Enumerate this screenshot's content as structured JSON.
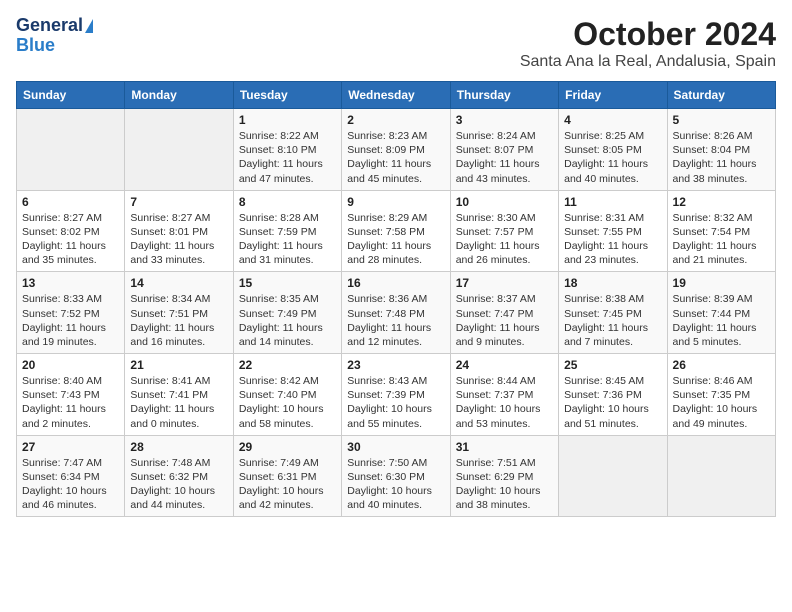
{
  "logo": {
    "line1": "General",
    "line2": "Blue"
  },
  "title": "October 2024",
  "subtitle": "Santa Ana la Real, Andalusia, Spain",
  "weekdays": [
    "Sunday",
    "Monday",
    "Tuesday",
    "Wednesday",
    "Thursday",
    "Friday",
    "Saturday"
  ],
  "weeks": [
    [
      {
        "day": "",
        "info": ""
      },
      {
        "day": "",
        "info": ""
      },
      {
        "day": "1",
        "sunrise": "8:22 AM",
        "sunset": "8:10 PM",
        "daylight": "11 hours and 47 minutes."
      },
      {
        "day": "2",
        "sunrise": "8:23 AM",
        "sunset": "8:09 PM",
        "daylight": "11 hours and 45 minutes."
      },
      {
        "day": "3",
        "sunrise": "8:24 AM",
        "sunset": "8:07 PM",
        "daylight": "11 hours and 43 minutes."
      },
      {
        "day": "4",
        "sunrise": "8:25 AM",
        "sunset": "8:05 PM",
        "daylight": "11 hours and 40 minutes."
      },
      {
        "day": "5",
        "sunrise": "8:26 AM",
        "sunset": "8:04 PM",
        "daylight": "11 hours and 38 minutes."
      }
    ],
    [
      {
        "day": "6",
        "sunrise": "8:27 AM",
        "sunset": "8:02 PM",
        "daylight": "11 hours and 35 minutes."
      },
      {
        "day": "7",
        "sunrise": "8:27 AM",
        "sunset": "8:01 PM",
        "daylight": "11 hours and 33 minutes."
      },
      {
        "day": "8",
        "sunrise": "8:28 AM",
        "sunset": "7:59 PM",
        "daylight": "11 hours and 31 minutes."
      },
      {
        "day": "9",
        "sunrise": "8:29 AM",
        "sunset": "7:58 PM",
        "daylight": "11 hours and 28 minutes."
      },
      {
        "day": "10",
        "sunrise": "8:30 AM",
        "sunset": "7:57 PM",
        "daylight": "11 hours and 26 minutes."
      },
      {
        "day": "11",
        "sunrise": "8:31 AM",
        "sunset": "7:55 PM",
        "daylight": "11 hours and 23 minutes."
      },
      {
        "day": "12",
        "sunrise": "8:32 AM",
        "sunset": "7:54 PM",
        "daylight": "11 hours and 21 minutes."
      }
    ],
    [
      {
        "day": "13",
        "sunrise": "8:33 AM",
        "sunset": "7:52 PM",
        "daylight": "11 hours and 19 minutes."
      },
      {
        "day": "14",
        "sunrise": "8:34 AM",
        "sunset": "7:51 PM",
        "daylight": "11 hours and 16 minutes."
      },
      {
        "day": "15",
        "sunrise": "8:35 AM",
        "sunset": "7:49 PM",
        "daylight": "11 hours and 14 minutes."
      },
      {
        "day": "16",
        "sunrise": "8:36 AM",
        "sunset": "7:48 PM",
        "daylight": "11 hours and 12 minutes."
      },
      {
        "day": "17",
        "sunrise": "8:37 AM",
        "sunset": "7:47 PM",
        "daylight": "11 hours and 9 minutes."
      },
      {
        "day": "18",
        "sunrise": "8:38 AM",
        "sunset": "7:45 PM",
        "daylight": "11 hours and 7 minutes."
      },
      {
        "day": "19",
        "sunrise": "8:39 AM",
        "sunset": "7:44 PM",
        "daylight": "11 hours and 5 minutes."
      }
    ],
    [
      {
        "day": "20",
        "sunrise": "8:40 AM",
        "sunset": "7:43 PM",
        "daylight": "11 hours and 2 minutes."
      },
      {
        "day": "21",
        "sunrise": "8:41 AM",
        "sunset": "7:41 PM",
        "daylight": "11 hours and 0 minutes."
      },
      {
        "day": "22",
        "sunrise": "8:42 AM",
        "sunset": "7:40 PM",
        "daylight": "10 hours and 58 minutes."
      },
      {
        "day": "23",
        "sunrise": "8:43 AM",
        "sunset": "7:39 PM",
        "daylight": "10 hours and 55 minutes."
      },
      {
        "day": "24",
        "sunrise": "8:44 AM",
        "sunset": "7:37 PM",
        "daylight": "10 hours and 53 minutes."
      },
      {
        "day": "25",
        "sunrise": "8:45 AM",
        "sunset": "7:36 PM",
        "daylight": "10 hours and 51 minutes."
      },
      {
        "day": "26",
        "sunrise": "8:46 AM",
        "sunset": "7:35 PM",
        "daylight": "10 hours and 49 minutes."
      }
    ],
    [
      {
        "day": "27",
        "sunrise": "7:47 AM",
        "sunset": "6:34 PM",
        "daylight": "10 hours and 46 minutes."
      },
      {
        "day": "28",
        "sunrise": "7:48 AM",
        "sunset": "6:32 PM",
        "daylight": "10 hours and 44 minutes."
      },
      {
        "day": "29",
        "sunrise": "7:49 AM",
        "sunset": "6:31 PM",
        "daylight": "10 hours and 42 minutes."
      },
      {
        "day": "30",
        "sunrise": "7:50 AM",
        "sunset": "6:30 PM",
        "daylight": "10 hours and 40 minutes."
      },
      {
        "day": "31",
        "sunrise": "7:51 AM",
        "sunset": "6:29 PM",
        "daylight": "10 hours and 38 minutes."
      },
      {
        "day": "",
        "info": ""
      },
      {
        "day": "",
        "info": ""
      }
    ]
  ]
}
